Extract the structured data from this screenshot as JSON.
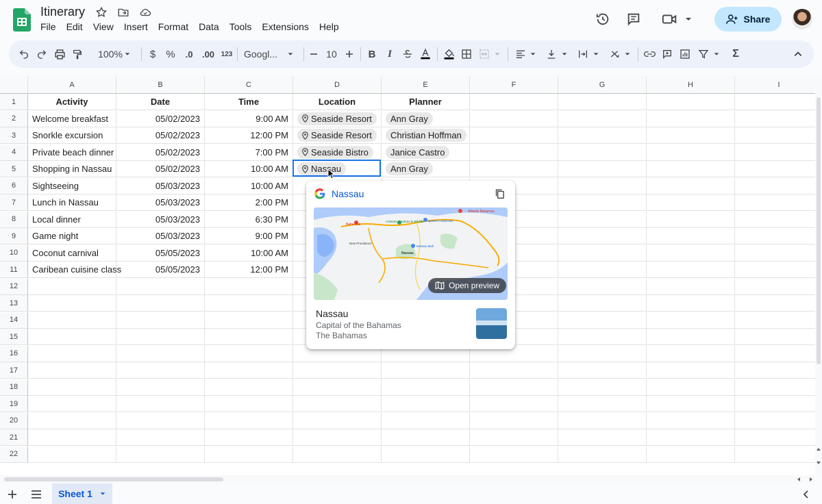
{
  "app": {
    "title": "Itinerary"
  },
  "menu": [
    "File",
    "Edit",
    "View",
    "Insert",
    "Format",
    "Data",
    "Tools",
    "Extensions",
    "Help"
  ],
  "header": {
    "share_label": "Share"
  },
  "toolbar": {
    "zoom": "100%",
    "currency": "$",
    "percent": "%",
    "dec_dec": ".0",
    "inc_dec": ".00",
    "format_123": "123",
    "font": "Googl...",
    "font_size": "10",
    "bold": "B",
    "italic": "I",
    "sum": "Σ"
  },
  "columns": [
    "A",
    "B",
    "C",
    "D",
    "E",
    "F",
    "G",
    "H",
    "I"
  ],
  "table": {
    "headers": [
      "Activity",
      "Date",
      "Time",
      "Location",
      "Planner"
    ],
    "rows": [
      {
        "activity": "Welcome breakfast",
        "date": "05/02/2023",
        "time": "9:00 AM",
        "location": "Seaside Resort",
        "planner": "Ann Gray"
      },
      {
        "activity": "Snorkle excursion",
        "date": "05/02/2023",
        "time": "12:00 PM",
        "location": "Seaside Resort",
        "planner": "Christian Hoffman"
      },
      {
        "activity": "Private beach dinner",
        "date": "05/02/2023",
        "time": "7:00 PM",
        "location": "Seaside Bistro",
        "planner": "Janice Castro"
      },
      {
        "activity": "Shopping in Nassau",
        "date": "05/02/2023",
        "time": "10:00 AM",
        "location": "Nassau",
        "planner": "Ann Gray"
      },
      {
        "activity": "Sightseeing",
        "date": "05/03/2023",
        "time": "10:00 AM",
        "location": "",
        "planner": ""
      },
      {
        "activity": "Lunch in Nassau",
        "date": "05/03/2023",
        "time": "2:00 PM",
        "location": "",
        "planner": ""
      },
      {
        "activity": "Local dinner",
        "date": "05/03/2023",
        "time": "6:30 PM",
        "location": "",
        "planner": ""
      },
      {
        "activity": "Game night",
        "date": "05/03/2023",
        "time": "9:00 PM",
        "location": "",
        "planner": ""
      },
      {
        "activity": "Coconut carnival",
        "date": "05/05/2023",
        "time": "10:00 AM",
        "location": "",
        "planner": ""
      },
      {
        "activity": "Caribean cuisine class",
        "date": "05/05/2023",
        "time": "12:00 PM",
        "location": "",
        "planner": ""
      }
    ]
  },
  "row_numbers": [
    "1",
    "2",
    "3",
    "4",
    "5",
    "6",
    "7",
    "8",
    "9",
    "10",
    "11",
    "12",
    "13",
    "14",
    "15",
    "16",
    "17",
    "18",
    "19",
    "20",
    "21",
    "22"
  ],
  "popup": {
    "title": "Nassau",
    "open_preview": "Open preview",
    "place_name": "Nassau",
    "place_desc": "Capital of the Bahamas",
    "place_country": "The Bahamas",
    "map_labels": [
      "Atlantis Bahamas",
      "Baha Mar",
      "Ardastra Gardens & Wildlife",
      "Queen's Staircase",
      "New Providence",
      "Nassau",
      "Nassau Mall"
    ]
  },
  "sheet": {
    "tab_label": "Sheet 1"
  },
  "colors": {
    "accent": "#0b57d0",
    "share_bg": "#c2e7ff",
    "selection": "#1a73e8"
  }
}
